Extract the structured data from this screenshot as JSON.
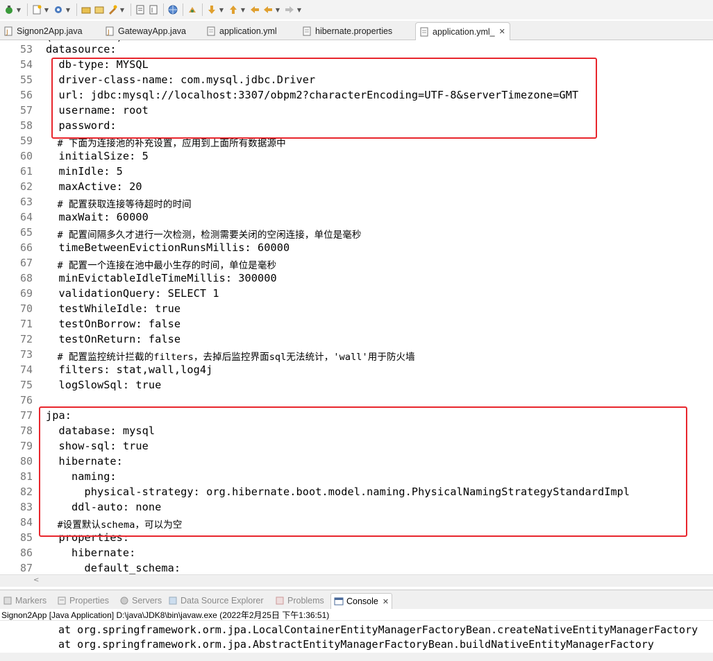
{
  "toolbar": {
    "icons": [
      "debug-icon",
      "run-icon",
      "new-icon",
      "settings-icon",
      "open-folder-icon",
      "open-file-icon",
      "build-icon",
      "task-list-icon",
      "outline-icon",
      "globe-icon",
      "search-icon",
      "next-annotation-icon",
      "prev-annotation-icon",
      "back-icon",
      "forward-icon"
    ]
  },
  "tabs": [
    {
      "label": "Signon2App.java",
      "type": "java"
    },
    {
      "label": "GatewayApp.java",
      "type": "java"
    },
    {
      "label": "application.yml",
      "type": "file"
    },
    {
      "label": "hibernate.properties",
      "type": "file"
    },
    {
      "label": "application.yml_",
      "type": "file",
      "active": true
    }
  ],
  "editor": {
    "partial_top": "(          )",
    "lines": [
      {
        "n": "53",
        "text": "datasource:"
      },
      {
        "n": "54",
        "text": "  db-type: MYSQL"
      },
      {
        "n": "55",
        "text": "  driver-class-name: com.mysql.jdbc.Driver"
      },
      {
        "n": "56",
        "text": "  url: jdbc:mysql://localhost:3307/obpm2?characterEncoding=UTF-8&serverTimezone=GMT"
      },
      {
        "n": "57",
        "text": "  username: root"
      },
      {
        "n": "58",
        "text": "  password:"
      },
      {
        "n": "59",
        "text": "  # 下面为连接池的补充设置，应用到上面所有数据源中",
        "cn": true
      },
      {
        "n": "60",
        "text": "  initialSize: 5"
      },
      {
        "n": "61",
        "text": "  minIdle: 5"
      },
      {
        "n": "62",
        "text": "  maxActive: 20"
      },
      {
        "n": "63",
        "text": "  # 配置获取连接等待超时的时间",
        "cn": true
      },
      {
        "n": "64",
        "text": "  maxWait: 60000"
      },
      {
        "n": "65",
        "text": "  # 配置间隔多久才进行一次检测，检测需要关闭的空闲连接，单位是毫秒",
        "cn": true
      },
      {
        "n": "66",
        "text": "  timeBetweenEvictionRunsMillis: 60000"
      },
      {
        "n": "67",
        "text": "  # 配置一个连接在池中最小生存的时间，单位是毫秒",
        "cn": true
      },
      {
        "n": "68",
        "text": "  minEvictableIdleTimeMillis: 300000"
      },
      {
        "n": "69",
        "text": "  validationQuery: SELECT 1"
      },
      {
        "n": "70",
        "text": "  testWhileIdle: true"
      },
      {
        "n": "71",
        "text": "  testOnBorrow: false"
      },
      {
        "n": "72",
        "text": "  testOnReturn: false"
      },
      {
        "n": "73",
        "text": "  # 配置监控统计拦截的filters，去掉后监控界面sql无法统计，'wall'用于防火墙",
        "cn": true
      },
      {
        "n": "74",
        "text": "  filters: stat,wall,log4j"
      },
      {
        "n": "75",
        "text": "  logSlowSql: true"
      },
      {
        "n": "76",
        "text": ""
      },
      {
        "n": "77",
        "text": "jpa:"
      },
      {
        "n": "78",
        "text": "  database: mysql"
      },
      {
        "n": "79",
        "text": "  show-sql: true"
      },
      {
        "n": "80",
        "text": "  hibernate:"
      },
      {
        "n": "81",
        "text": "    naming:"
      },
      {
        "n": "82",
        "text": "      physical-strategy: org.hibernate.boot.model.naming.PhysicalNamingStrategyStandardImpl"
      },
      {
        "n": "83",
        "text": "    ddl-auto: none"
      },
      {
        "n": "84",
        "text": "  #设置默认schema，可以为空",
        "cn": true
      },
      {
        "n": "85",
        "text": "  properties:"
      },
      {
        "n": "86",
        "text": "    hibernate:"
      },
      {
        "n": "87",
        "text": "      default_schema:"
      }
    ]
  },
  "views": [
    {
      "label": "Markers",
      "icon": "markers-icon"
    },
    {
      "label": "Properties",
      "icon": "properties-icon"
    },
    {
      "label": "Servers",
      "icon": "servers-icon"
    },
    {
      "label": "Data Source Explorer",
      "icon": "data-source-icon"
    },
    {
      "label": "Problems",
      "icon": "problems-icon"
    },
    {
      "label": "Console",
      "icon": "console-icon",
      "active": true
    }
  ],
  "console": {
    "header": "Signon2App [Java Application] D:\\java\\JDK8\\bin\\javaw.exe (2022年2月25日 下午1:36:51)",
    "lines": [
      "at org.springframework.orm.jpa.LocalContainerEntityManagerFactoryBean.createNativeEntityManagerFactory",
      "at org.springframework.orm.jpa.AbstractEntityManagerFactoryBean.buildNativeEntityManagerFactory"
    ]
  },
  "colors": {
    "highlight_box": "#e8262d",
    "line_number": "#787878"
  }
}
